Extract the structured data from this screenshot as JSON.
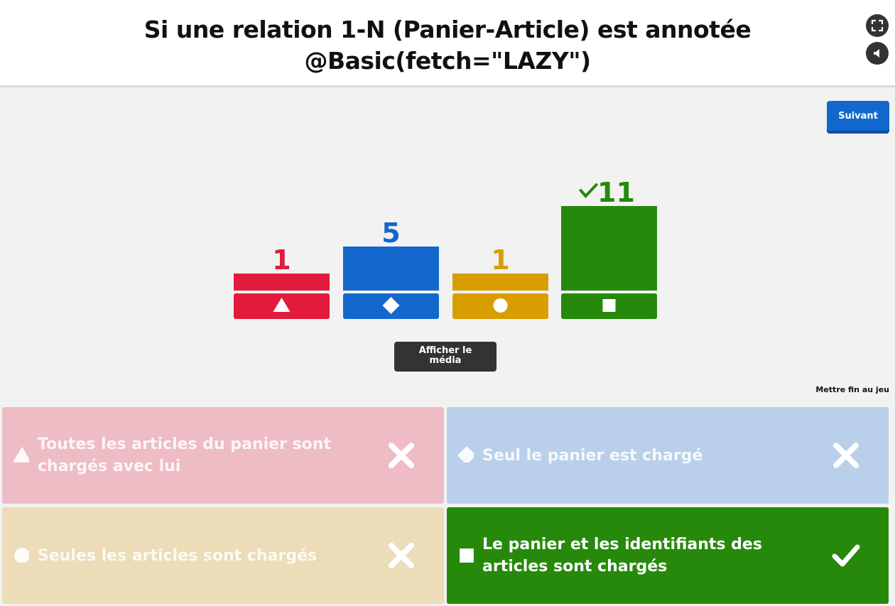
{
  "question": {
    "title_line1": "Si une relation 1-N (Panier-Article) est annotée",
    "title_line2": "@Basic(fetch=\"LAZY\")"
  },
  "controls": {
    "fullscreen_icon": "fullscreen-icon",
    "sound_icon": "sound-icon",
    "next_label": "Suivant",
    "media_label_line1": "Afficher le",
    "media_label_line2": "média",
    "end_game_label": "Mettre fin au jeu"
  },
  "colors": {
    "red": "#e21b3c",
    "blue": "#1368ce",
    "yellow": "#d89e00",
    "green": "#26890c"
  },
  "chart_data": {
    "type": "bar",
    "categories": [
      "triangle",
      "diamond",
      "circle",
      "square"
    ],
    "values": [
      1,
      5,
      1,
      11
    ],
    "value_labels": [
      "1",
      "5",
      "1",
      "11"
    ],
    "correct_index": 3,
    "colors": [
      "#e21b3c",
      "#1368ce",
      "#d89e00",
      "#26890c"
    ],
    "ylim": [
      0,
      11
    ]
  },
  "answers": [
    {
      "shape": "triangle",
      "text": "Toutes les articles du panier sont chargés avec lui",
      "correct": false,
      "color": "#e21b3c"
    },
    {
      "shape": "diamond",
      "text": "Seul le panier est chargé",
      "correct": false,
      "color": "#1368ce"
    },
    {
      "shape": "circle",
      "text": "Seules les articles sont chargés",
      "correct": false,
      "color": "#d89e00"
    },
    {
      "shape": "square",
      "text": "Le panier et les identifiants des articles sont chargés",
      "correct": true,
      "color": "#26890c"
    }
  ]
}
